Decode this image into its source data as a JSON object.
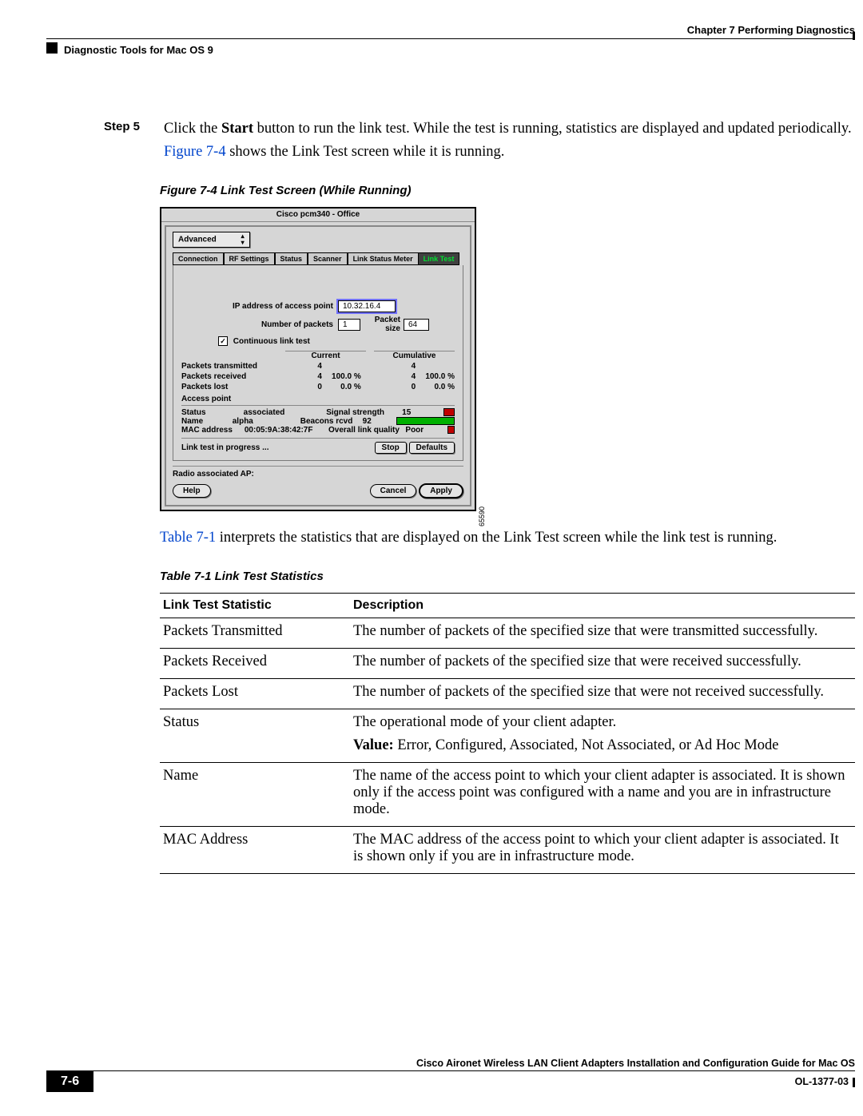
{
  "header": {
    "chapter": "Chapter 7      Performing Diagnostics",
    "section": "Diagnostic Tools for Mac OS 9"
  },
  "step": {
    "label": "Step 5",
    "text_a": "Click the ",
    "text_b": "Start",
    "text_c": " button to run the link test. While the test is running, statistics are displayed and updated periodically.",
    "fig_link": "Figure 7-4",
    "fig_after": " shows the Link Test screen while it is running."
  },
  "figure": {
    "caption": "Figure 7-4    Link Test Screen (While Running)",
    "id": "65590",
    "win_title": "Cisco pcm340 - Office",
    "dropdown": "Advanced",
    "tabs": [
      "Connection",
      "RF Settings",
      "Status",
      "Scanner",
      "Link Status Meter",
      "Link Test"
    ],
    "ip_label": "IP address of access point",
    "ip_value": "10.32.16.4",
    "np_label": "Number of packets",
    "np_value": "1",
    "ps_label": "Packet size",
    "ps_value": "64",
    "cont_label": "Continuous link test",
    "col1": "Current",
    "col2": "Cumulative",
    "rows": [
      {
        "label": "Packets transmitted",
        "c1": "4",
        "p1": "",
        "c2": "4",
        "p2": ""
      },
      {
        "label": "Packets received",
        "c1": "4",
        "p1": "100.0 %",
        "c2": "4",
        "p2": "100.0 %"
      },
      {
        "label": "Packets lost",
        "c1": "0",
        "p1": "0.0 %",
        "c2": "0",
        "p2": "0.0 %"
      }
    ],
    "ap_header": "Access point",
    "ap": {
      "status_k": "Status",
      "status_v": "associated",
      "name_k": "Name",
      "name_v": "alpha",
      "mac_k": "MAC address",
      "mac_v": "00:05:9A:38:42:7F",
      "sig_k": "Signal strength",
      "sig_v": "15",
      "bcn_k": "Beacons rcvd",
      "bcn_v": "92",
      "olq_k": "Overall link quality",
      "olq_v": "Poor"
    },
    "progress": "Link test in progress ...",
    "btn_stop": "Stop",
    "btn_defaults": "Defaults",
    "radio_assoc": "Radio associated  AP:",
    "btn_help": "Help",
    "btn_cancel": "Cancel",
    "btn_apply": "Apply"
  },
  "post_fig": {
    "tbl_link": "Table 7-1",
    "after": " interprets the statistics that are displayed on the Link Test screen while the link test is running."
  },
  "table": {
    "caption": "Table 7-1    Link Test Statistics",
    "h1": "Link Test Statistic",
    "h2": "Description",
    "rows": [
      {
        "a": "Packets Transmitted",
        "b": "The number of packets of the specified size that were transmitted successfully."
      },
      {
        "a": "Packets Received",
        "b": "The number of packets of the specified size that were received successfully."
      },
      {
        "a": "Packets Lost",
        "b": "The number of packets of the specified size that were not received successfully."
      },
      {
        "a": "Status",
        "b": "The operational mode of your client adapter.",
        "b2_strong": "Value:",
        "b2": " Error, Configured, Associated, Not Associated, or Ad Hoc Mode"
      },
      {
        "a": "Name",
        "b": "The name of the access point to which your client adapter is associated. It is shown only if the access point was configured with a name and you are in infrastructure mode."
      },
      {
        "a": "MAC Address",
        "b": "The MAC address of the access point to which your client adapter is associated. It is shown only if you are in infrastructure mode."
      }
    ]
  },
  "footer": {
    "title": "Cisco Aironet Wireless LAN Client Adapters Installation and Configuration Guide for Mac OS",
    "page": "7-6",
    "ol": "OL-1377-03"
  }
}
